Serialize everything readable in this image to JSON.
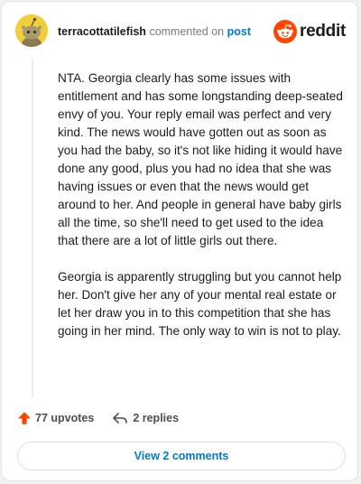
{
  "comment": {
    "author": "terracottatilefish",
    "commented_text": "commented on",
    "post_link": "post",
    "paragraphs": [
      "NTA. Georgia clearly has some issues with entitlement and has some longstanding deep-seated envy of you. Your reply email was perfect and very kind. The news would have gotten out as soon as you had the baby, so it's not like hiding it would have done any good, plus you had no idea that she was having issues or even that the news would get around to her. And people in general have baby girls all the time, so she'll need to get used to the idea that there are a lot of little girls out there.",
      "Georgia is apparently struggling but you cannot help her. Don't give her any of your mental real estate or let her draw you in to this competition that she has going in her mind. The only way to win is not to play."
    ]
  },
  "brand": {
    "wordmark": "reddit",
    "icon": "reddit-snoo-icon",
    "color": "#ff4500"
  },
  "actions": {
    "upvotes": "77 upvotes",
    "upvote_icon": "upvote-arrow-icon",
    "upvote_color": "#ff4500",
    "replies": "2 replies",
    "reply_icon": "reply-arrow-icon"
  },
  "view_comments": {
    "label": "View 2 comments"
  }
}
